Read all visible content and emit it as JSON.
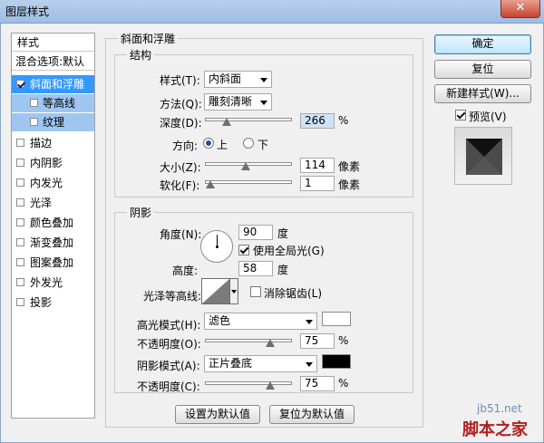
{
  "window": {
    "title": "图层样式",
    "close_glyph": "✕"
  },
  "left_panel": {
    "header": "样式",
    "items": [
      {
        "label": "混合选项:默认",
        "type": "header"
      },
      {
        "label": "斜面和浮雕",
        "checked": true,
        "selected": true
      },
      {
        "label": "等高线",
        "checked": false,
        "sub": true
      },
      {
        "label": "纹理",
        "checked": false,
        "sub": true
      },
      {
        "label": "描边",
        "checked": false
      },
      {
        "label": "内阴影",
        "checked": false
      },
      {
        "label": "内发光",
        "checked": false
      },
      {
        "label": "光泽",
        "checked": false
      },
      {
        "label": "颜色叠加",
        "checked": false
      },
      {
        "label": "渐变叠加",
        "checked": false
      },
      {
        "label": "图案叠加",
        "checked": false
      },
      {
        "label": "外发光",
        "checked": false
      },
      {
        "label": "投影",
        "checked": false
      }
    ]
  },
  "bevel": {
    "group_title": "斜面和浮雕",
    "structure": {
      "title": "结构",
      "style_label": "样式(T):",
      "style_value": "内斜面",
      "technique_label": "方法(Q):",
      "technique_value": "雕刻清晰",
      "depth_label": "深度(D):",
      "depth_value": "266",
      "depth_unit": "%",
      "depth_level": 0.25,
      "direction_label": "方向:",
      "dir_up": "上",
      "dir_down": "下",
      "dir_selected": "up",
      "size_label": "大小(Z):",
      "size_value": "114",
      "size_unit": "像素",
      "size_level": 0.46,
      "soften_label": "软化(F):",
      "soften_value": "1",
      "soften_unit": "像素",
      "soften_level": 0.02
    },
    "shading": {
      "title": "阴影",
      "angle_label": "角度(N):",
      "angle_value": "90",
      "angle_unit": "度",
      "global_light_label": "使用全局光(G)",
      "global_light": true,
      "altitude_label": "高度:",
      "altitude_value": "58",
      "altitude_unit": "度",
      "gloss_label": "光泽等高线:",
      "antialias_label": "消除锯齿(L)",
      "antialias": false,
      "highlight_mode_label": "高光模式(H):",
      "highlight_mode_value": "滤色",
      "highlight_color": "#ffffff",
      "highlight_opacity_label": "不透明度(O):",
      "highlight_opacity_value": "75",
      "highlight_opacity_unit": "%",
      "highlight_opacity_level": 0.75,
      "shadow_mode_label": "阴影模式(A):",
      "shadow_mode_value": "正片叠底",
      "shadow_color": "#000000",
      "shadow_opacity_label": "不透明度(C):",
      "shadow_opacity_value": "75",
      "shadow_opacity_unit": "%",
      "shadow_opacity_level": 0.75
    },
    "set_default": "设置为默认值",
    "reset_default": "复位为默认值"
  },
  "buttons": {
    "ok": "确定",
    "reset": "复位",
    "new_style": "新建样式(W)...",
    "preview_label": "预览(V)",
    "preview": true
  },
  "watermark": {
    "site": "jb51.net",
    "name": "脚本之家"
  },
  "colors": {
    "selection": "#3399ff",
    "sub_selection": "#9ec6f1",
    "title_bar": "#b7d0ec"
  }
}
